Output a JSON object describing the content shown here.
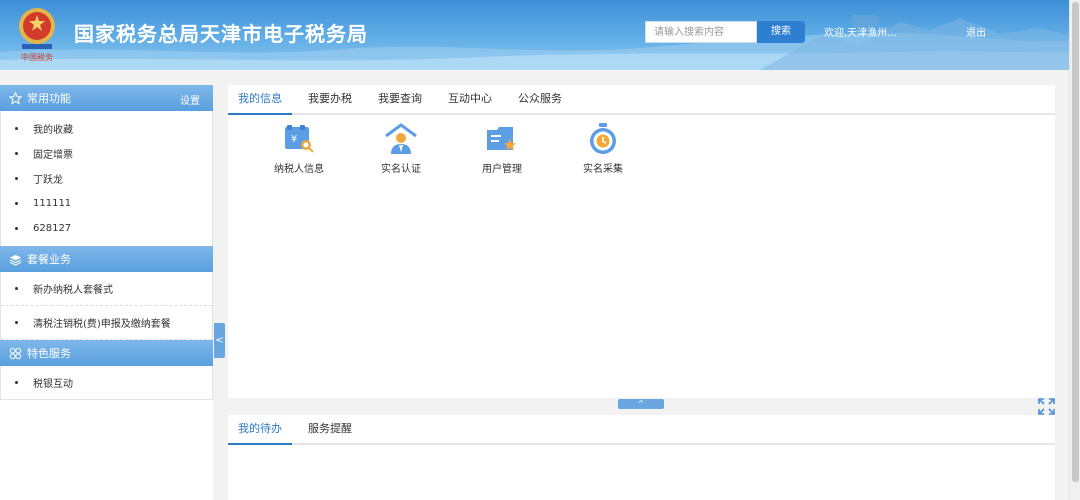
{
  "header": {
    "title": "国家税务总局天津市电子税务局",
    "search_placeholder": "请输入搜索内容",
    "search_button": "搜索",
    "welcome": "欢迎,天津渔州...",
    "logout": "退出",
    "emblem_text": "中国税务",
    "colors": {
      "top": "#3d8fd6",
      "bottom": "#8cc6ee"
    }
  },
  "sidebar": {
    "common": {
      "title": "常用功能",
      "settings": "设置",
      "icon": "star-icon",
      "items": [
        "我的收藏",
        "固定增票",
        "丁跃龙",
        "111111",
        "628127"
      ]
    },
    "package": {
      "title": "套餐业务",
      "icon": "layers-icon",
      "items": [
        "新办纳税人套餐式",
        "清税注销税(费)申报及缴纳套餐"
      ]
    },
    "special": {
      "title": "特色服务",
      "icon": "grid-icon",
      "items": [
        "税银互动"
      ]
    },
    "collapse_glyph": "<"
  },
  "main": {
    "tabs": [
      "我的信息",
      "我要办税",
      "我要查询",
      "互动中心",
      "公众服务"
    ],
    "active_tab": "我的信息",
    "apps": [
      {
        "label": "纳税人信息",
        "icon": "taxpayer-info-icon"
      },
      {
        "label": "实名认证",
        "icon": "real-name-auth-icon"
      },
      {
        "label": "用户管理",
        "icon": "user-management-icon"
      },
      {
        "label": "实名采集",
        "icon": "real-name-collect-icon"
      }
    ],
    "split_glyph": "^"
  },
  "bottom": {
    "tabs": [
      "我的待办",
      "服务提醒"
    ],
    "active_tab": "我的待办"
  },
  "accent": "#2f78c2"
}
